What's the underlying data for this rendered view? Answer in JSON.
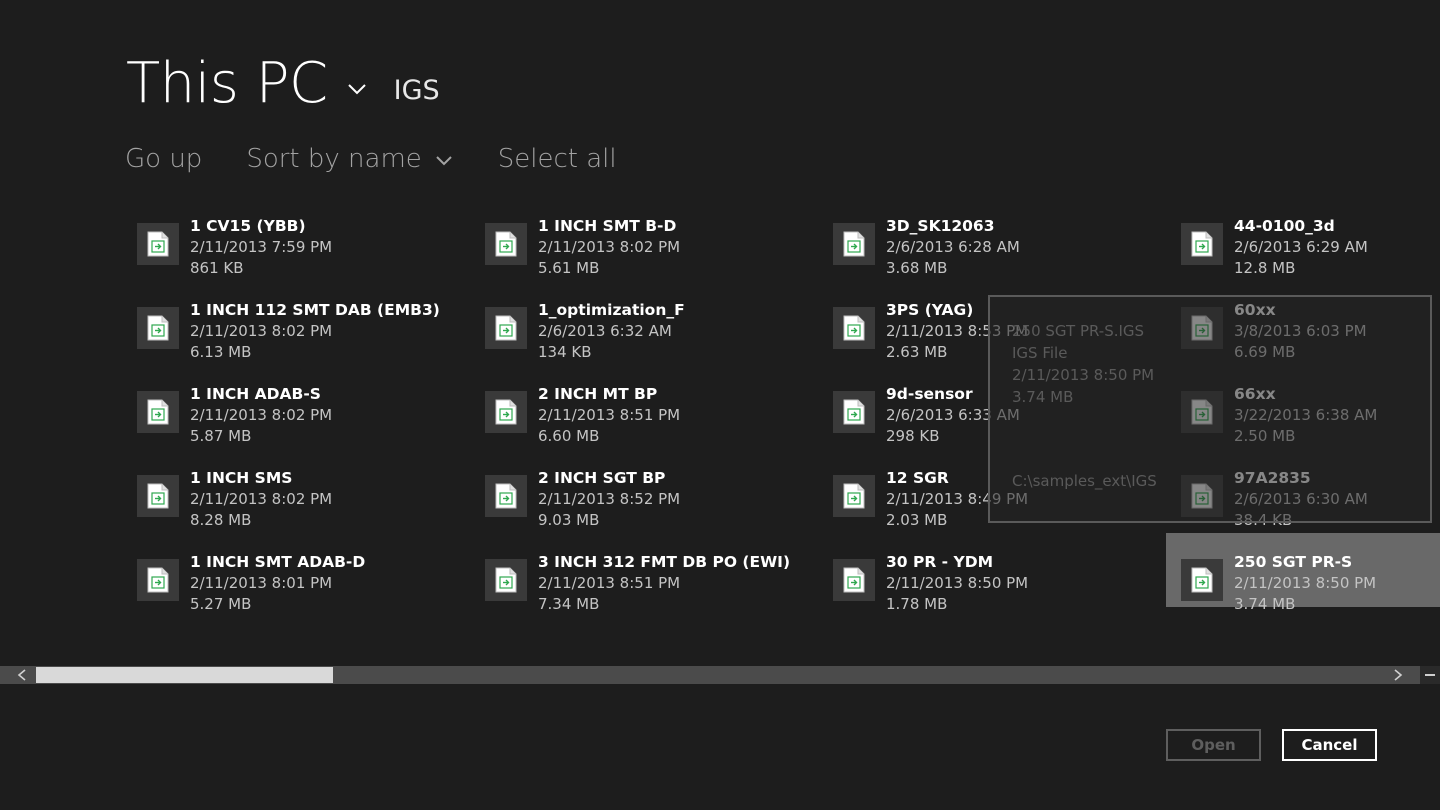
{
  "header": {
    "location": "This PC",
    "folder": "IGS"
  },
  "commands": {
    "go_up": "Go up",
    "sort": "Sort by name",
    "select_all": "Select all"
  },
  "files": [
    {
      "name": "1 CV15 (YBB)",
      "date": "2/11/2013 7:59 PM",
      "size": "861 KB"
    },
    {
      "name": "1 INCH 112 SMT DAB (EMB3)",
      "date": "2/11/2013 8:02 PM",
      "size": "6.13 MB"
    },
    {
      "name": "1 INCH ADAB-S",
      "date": "2/11/2013 8:02 PM",
      "size": "5.87 MB"
    },
    {
      "name": "1 INCH SMS",
      "date": "2/11/2013 8:02 PM",
      "size": "8.28 MB"
    },
    {
      "name": "1 INCH SMT ADAB-D",
      "date": "2/11/2013 8:01 PM",
      "size": "5.27 MB"
    },
    {
      "name": "1 INCH SMT B-D",
      "date": "2/11/2013 8:02 PM",
      "size": "5.61 MB"
    },
    {
      "name": "1_optimization_F",
      "date": "2/6/2013 6:32 AM",
      "size": "134 KB"
    },
    {
      "name": "2 INCH MT BP",
      "date": "2/11/2013 8:51 PM",
      "size": "6.60 MB"
    },
    {
      "name": "2 INCH SGT BP",
      "date": "2/11/2013 8:52 PM",
      "size": "9.03 MB"
    },
    {
      "name": "3 INCH 312 FMT DB PO (EWI)",
      "date": "2/11/2013 8:51 PM",
      "size": "7.34 MB"
    },
    {
      "name": "3D_SK12063",
      "date": "2/6/2013 6:28 AM",
      "size": "3.68 MB"
    },
    {
      "name": "3PS (YAG)",
      "date": "2/11/2013 8:53 PM",
      "size": "2.63 MB"
    },
    {
      "name": "9d-sensor",
      "date": "2/6/2013 6:33 AM",
      "size": "298 KB"
    },
    {
      "name": "12 SGR",
      "date": "2/11/2013 8:49 PM",
      "size": "2.03 MB"
    },
    {
      "name": "30 PR - YDM",
      "date": "2/11/2013 8:50 PM",
      "size": "1.78 MB"
    },
    {
      "name": "44-0100_3d",
      "date": "2/6/2013 6:29 AM",
      "size": "12.8 MB"
    },
    {
      "name": "60xx",
      "date": "3/8/2013 6:03 PM",
      "size": "6.69 MB"
    },
    {
      "name": "66xx",
      "date": "3/22/2013 6:38 AM",
      "size": "2.50 MB"
    },
    {
      "name": "97A2835",
      "date": "2/6/2013 6:30 AM",
      "size": "38.4 KB"
    },
    {
      "name": "250 SGT PR-S",
      "date": "2/11/2013 8:50 PM",
      "size": "3.74 MB"
    }
  ],
  "selected_file_index": 19,
  "tooltip": {
    "title": "250 SGT PR-S.IGS",
    "type": "IGS File",
    "date": "2/11/2013 8:50 PM",
    "size": "3.74 MB",
    "path": "C:\\samples_ext\\IGS"
  },
  "scrollbar": {
    "position": 0.0,
    "visible_fraction": 0.22
  },
  "buttons": {
    "open": "Open",
    "cancel": "Cancel"
  },
  "colors": {
    "background": "#1d1d1d",
    "selection": "#696969",
    "file_icon_accent": "#2fa84f"
  },
  "icons": {
    "location_dropdown": "chevron-down-icon",
    "sort_dropdown": "chevron-down-icon",
    "file": "igs-file-icon",
    "scroll_left": "chevron-left-icon",
    "scroll_right": "chevron-right-icon"
  }
}
